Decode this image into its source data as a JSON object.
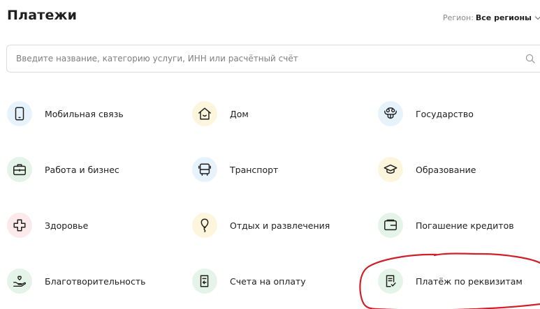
{
  "page": {
    "title": "Платежи",
    "region_label": "Регион:",
    "region_value": "Все регионы"
  },
  "search": {
    "placeholder": "Введите название, категорию услуги, ИНН или расчётный счёт",
    "value": ""
  },
  "categories": [
    {
      "label": "Мобильная связь",
      "icon": "smartphone-icon",
      "bg": "#e6f3fc"
    },
    {
      "label": "Дом",
      "icon": "house-icon",
      "bg": "#fdf5dc"
    },
    {
      "label": "Государство",
      "icon": "government-emblem-icon",
      "bg": "#e6f3fc"
    },
    {
      "label": "Работа и бизнес",
      "icon": "briefcase-icon",
      "bg": "#e5f4e9"
    },
    {
      "label": "Транспорт",
      "icon": "bus-icon",
      "bg": "#e6f3fc"
    },
    {
      "label": "Образование",
      "icon": "graduation-cap-icon",
      "bg": "#fdf5dc"
    },
    {
      "label": "Здоровье",
      "icon": "medical-cross-icon",
      "bg": "#fce9ec"
    },
    {
      "label": "Отдых и развлечения",
      "icon": "balloon-icon",
      "bg": "#fdf5dc"
    },
    {
      "label": "Погашение кредитов",
      "icon": "wallet-icon",
      "bg": "#e5f4e9"
    },
    {
      "label": "Благотворительность",
      "icon": "charity-hand-heart-icon",
      "bg": "#e5f4e9"
    },
    {
      "label": "Счета на оплату",
      "icon": "invoice-arrow-icon",
      "bg": "#e5f4e9"
    },
    {
      "label": "Платёж по реквизитам",
      "icon": "document-check-icon",
      "bg": "#e5f4e9"
    }
  ],
  "colors": {
    "icon_stroke": "#1f1f1f",
    "annotation_red": "#d0202a"
  }
}
